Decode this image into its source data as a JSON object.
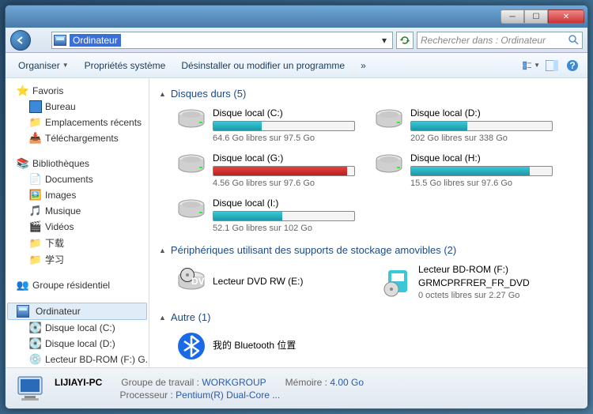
{
  "address": {
    "text": "Ordinateur",
    "search_placeholder": "Rechercher dans : Ordinateur"
  },
  "toolbar": {
    "organize": "Organiser",
    "properties": "Propriétés système",
    "uninstall": "Désinstaller ou modifier un programme",
    "more": "»"
  },
  "sidebar": {
    "favorites": {
      "head": "Favoris",
      "items": [
        "Bureau",
        "Emplacements récents",
        "Téléchargements"
      ]
    },
    "libraries": {
      "head": "Bibliothèques",
      "items": [
        "Documents",
        "Images",
        "Musique",
        "Vidéos",
        "下载",
        "学习"
      ]
    },
    "homegroup": "Groupe résidentiel",
    "computer": {
      "head": "Ordinateur",
      "items": [
        "Disque local (C:)",
        "Disque local (D:)",
        "Lecteur BD-ROM (F:) G..."
      ]
    }
  },
  "sections": {
    "hdd": {
      "title": "Disques durs (5)",
      "drives": [
        {
          "name": "Disque local (C:)",
          "free": "64.6 Go libres sur 97.5 Go",
          "fill": 34,
          "color": "teal"
        },
        {
          "name": "Disque local (D:)",
          "free": "202 Go libres sur 338 Go",
          "fill": 40,
          "color": "teal"
        },
        {
          "name": "Disque local (G:)",
          "free": "4.56 Go libres sur 97.6 Go",
          "fill": 95,
          "color": "red"
        },
        {
          "name": "Disque local (H:)",
          "free": "15.5 Go libres sur 97.6 Go",
          "fill": 84,
          "color": "teal"
        },
        {
          "name": "Disque local (I:)",
          "free": "52.1 Go libres sur 102 Go",
          "fill": 49,
          "color": "teal"
        }
      ]
    },
    "removable": {
      "title": "Périphériques utilisant des supports de stockage amovibles (2)",
      "items": [
        {
          "name": "Lecteur DVD RW (E:)",
          "sub": "",
          "extra": ""
        },
        {
          "name": "Lecteur BD-ROM (F:)",
          "sub": "GRMCPRFRER_FR_DVD",
          "extra": "0 octets libres sur 2.27 Go"
        }
      ]
    },
    "other": {
      "title": "Autre (1)",
      "items": [
        {
          "name": "我的 Bluetooth 位置"
        }
      ]
    }
  },
  "status": {
    "computer_name": "LIJIAYI-PC",
    "workgroup_label": "Groupe de travail :",
    "workgroup": "WORKGROUP",
    "mem_label": "Mémoire :",
    "mem": "4.00 Go",
    "cpu_label": "Processeur :",
    "cpu": "Pentium(R) Dual-Core ..."
  }
}
